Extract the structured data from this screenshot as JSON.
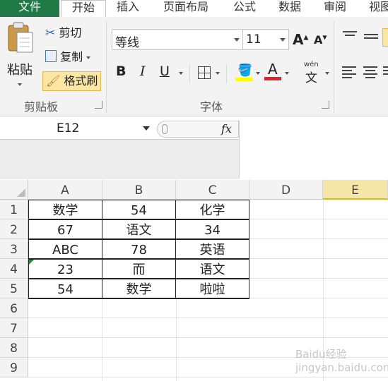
{
  "tabs": [
    "文件",
    "开始",
    "插入",
    "页面布局",
    "公式",
    "数据",
    "审阅",
    "视图"
  ],
  "clipboard": {
    "paste_label": "粘贴",
    "cut_label": "剪切",
    "copy_label": "复制",
    "format_painter_label": "格式刷",
    "group_label": "剪贴板"
  },
  "font": {
    "font_name": "等线",
    "font_size": "11",
    "group_label": "字体",
    "bold": "B",
    "italic": "I",
    "underline": "U",
    "font_color_letter": "A",
    "wen_glyph": "wén",
    "wen_char": "文",
    "grow_letter": "A",
    "shrink_letter": "A",
    "fill_color": "#ffff00",
    "font_color": "#e0202a"
  },
  "name_box": "E12",
  "fx_label": "fx",
  "columns": [
    "A",
    "B",
    "C",
    "D",
    "E"
  ],
  "rows": [
    "1",
    "2",
    "3",
    "4",
    "5",
    "6",
    "7",
    "8",
    "9"
  ],
  "cells": [
    [
      "数学",
      "54",
      "化学"
    ],
    [
      "67",
      "语文",
      "34"
    ],
    [
      "ABC",
      "78",
      "英语"
    ],
    [
      "23",
      "而",
      "语文"
    ],
    [
      "54",
      "数学",
      "啦啦"
    ]
  ],
  "watermark": "Baidu经验 jingyan.baidu.com"
}
